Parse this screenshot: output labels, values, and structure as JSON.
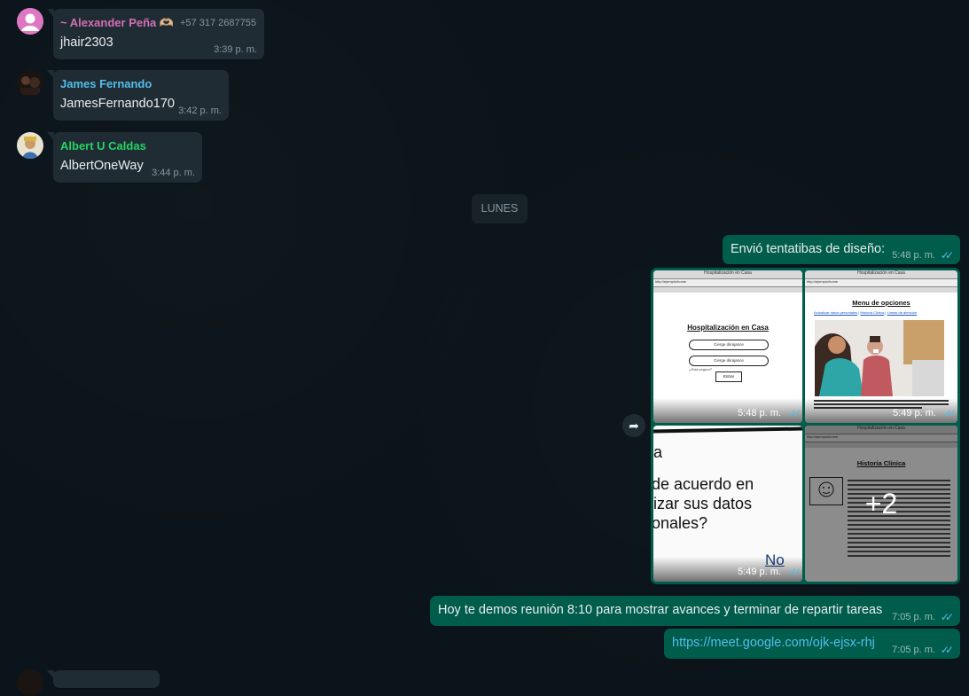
{
  "messages_in": [
    {
      "sender": "~ Alexander Peña 🫶🏼",
      "phone": "+57 317 2687755",
      "text": "jhair2303",
      "time": "3:39 p. m.",
      "sender_color": "#d36fb5"
    },
    {
      "sender": "James Fernando",
      "text": "JamesFernando170",
      "time": "3:42 p. m.",
      "sender_color": "#53bdeb"
    },
    {
      "sender": "Albert U Caldas",
      "text": "AlbertOneWay",
      "time": "3:44 p. m.",
      "sender_color": "#25d366"
    }
  ],
  "date_divider": "LUNES",
  "messages_out": [
    {
      "text": "Envió tentatibas de diseño:",
      "time": "5:48 p. m.",
      "status": "read"
    },
    {
      "text": "Hoy te demos reunión 8:10 para mostrar avances y terminar de repartir tareas",
      "time": "7:05 p. m.",
      "status": "read"
    },
    {
      "text": "https://meet.google.com/ojk-ejsx-rhj",
      "time": "7:05 p. m.",
      "status": "read"
    }
  ],
  "album": {
    "tiles": [
      {
        "time": "5:48 p. m.",
        "caption": "Hospitalización en Casa",
        "url": "http://ejemplo/home",
        "title": "Hospitalización en Casa",
        "field1": "Cierge diirajance",
        "field2": "Cierge diirajance",
        "hint": "¿Está seguro?",
        "button": "Entrar"
      },
      {
        "time": "5:49 p. m.",
        "caption": "Hospitalización en Casa",
        "url": "http://ejemplo/home",
        "title": "Menu de opciones",
        "links": [
          "Actualizar datos personales",
          "Historia Clínica",
          "Lineas de atención"
        ]
      },
      {
        "time": "5:49 p. m.",
        "lines": [
          "a",
          "de acuerdo en",
          "lizar sus datos",
          "onales?"
        ],
        "button": "No"
      },
      {
        "caption": "Hospitalización en Casa",
        "url": "http://ejemplo/home",
        "title": "Historia Clínica",
        "more": "+2"
      }
    ]
  },
  "colors": {
    "incoming_bubble": "#202c33",
    "outgoing_bubble": "#005c4b",
    "read_ticks": "#53bdeb",
    "link": "#53bdeb"
  },
  "icons": {
    "forward": "forward-arrow-icon",
    "read": "double-check-icon"
  }
}
